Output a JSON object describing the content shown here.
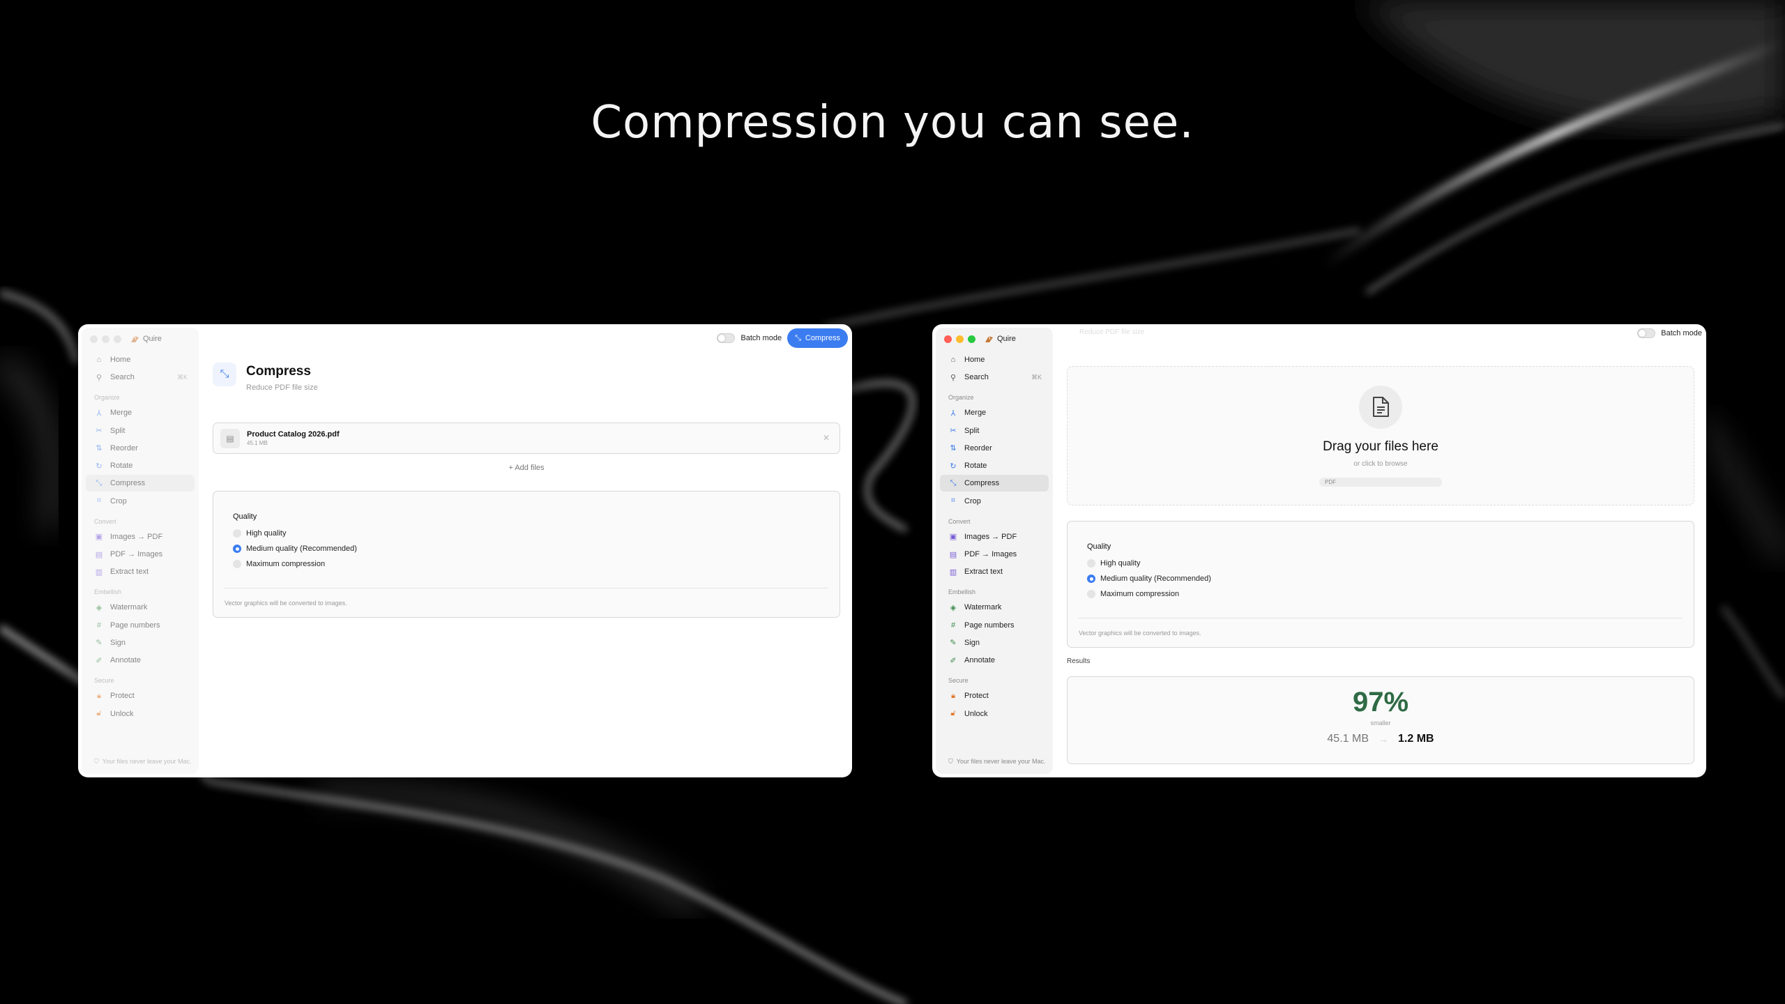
{
  "headline": "Compression you can see.",
  "app": {
    "name": "Quire"
  },
  "colors": {
    "accent": "#3b7cf0",
    "success": "#2f6b45"
  },
  "sidebar": {
    "home": "Home",
    "search": "Search",
    "search_shortcut": "⌘K",
    "sections": {
      "organize": "Organize",
      "convert": "Convert",
      "embellish": "Embellish",
      "secure": "Secure"
    },
    "organize_items": [
      {
        "label": "Merge",
        "icon": "merge-icon"
      },
      {
        "label": "Split",
        "icon": "scissors-icon"
      },
      {
        "label": "Reorder",
        "icon": "reorder-icon"
      },
      {
        "label": "Rotate",
        "icon": "rotate-icon"
      },
      {
        "label": "Compress",
        "icon": "compress-icon"
      },
      {
        "label": "Crop",
        "icon": "crop-icon"
      }
    ],
    "convert_items": [
      {
        "label": "Images → PDF",
        "icon": "image-icon"
      },
      {
        "label": "PDF → Images",
        "icon": "document-icon"
      },
      {
        "label": "Extract text",
        "icon": "text-icon"
      }
    ],
    "embellish_items": [
      {
        "label": "Watermark",
        "icon": "watermark-icon"
      },
      {
        "label": "Page numbers",
        "icon": "hash-icon"
      },
      {
        "label": "Sign",
        "icon": "signature-icon"
      },
      {
        "label": "Annotate",
        "icon": "pen-icon"
      }
    ],
    "secure_items": [
      {
        "label": "Protect",
        "icon": "lock-icon"
      },
      {
        "label": "Unlock",
        "icon": "unlock-icon"
      }
    ],
    "privacy_note": "Your files never leave your Mac."
  },
  "toolbar": {
    "batch_mode": "Batch mode",
    "compress_button": "Compress"
  },
  "tool": {
    "title": "Compress",
    "subtitle": "Reduce PDF file size"
  },
  "file": {
    "name": "Product Catalog 2026.pdf",
    "size": "45.1 MB"
  },
  "add_files": "Add files",
  "quality": {
    "heading": "Quality",
    "options": [
      "High quality",
      "Medium quality (Recommended)",
      "Maximum compression"
    ],
    "selected_index": 1,
    "note": "Vector graphics will be converted to images."
  },
  "dropzone": {
    "title": "Drag your files here",
    "subtitle": "or click to browse",
    "chip": "PDF"
  },
  "results": {
    "label": "Results",
    "percent": "97%",
    "percent_caption": "smaller",
    "original_size": "45.1 MB",
    "new_size": "1.2 MB"
  }
}
